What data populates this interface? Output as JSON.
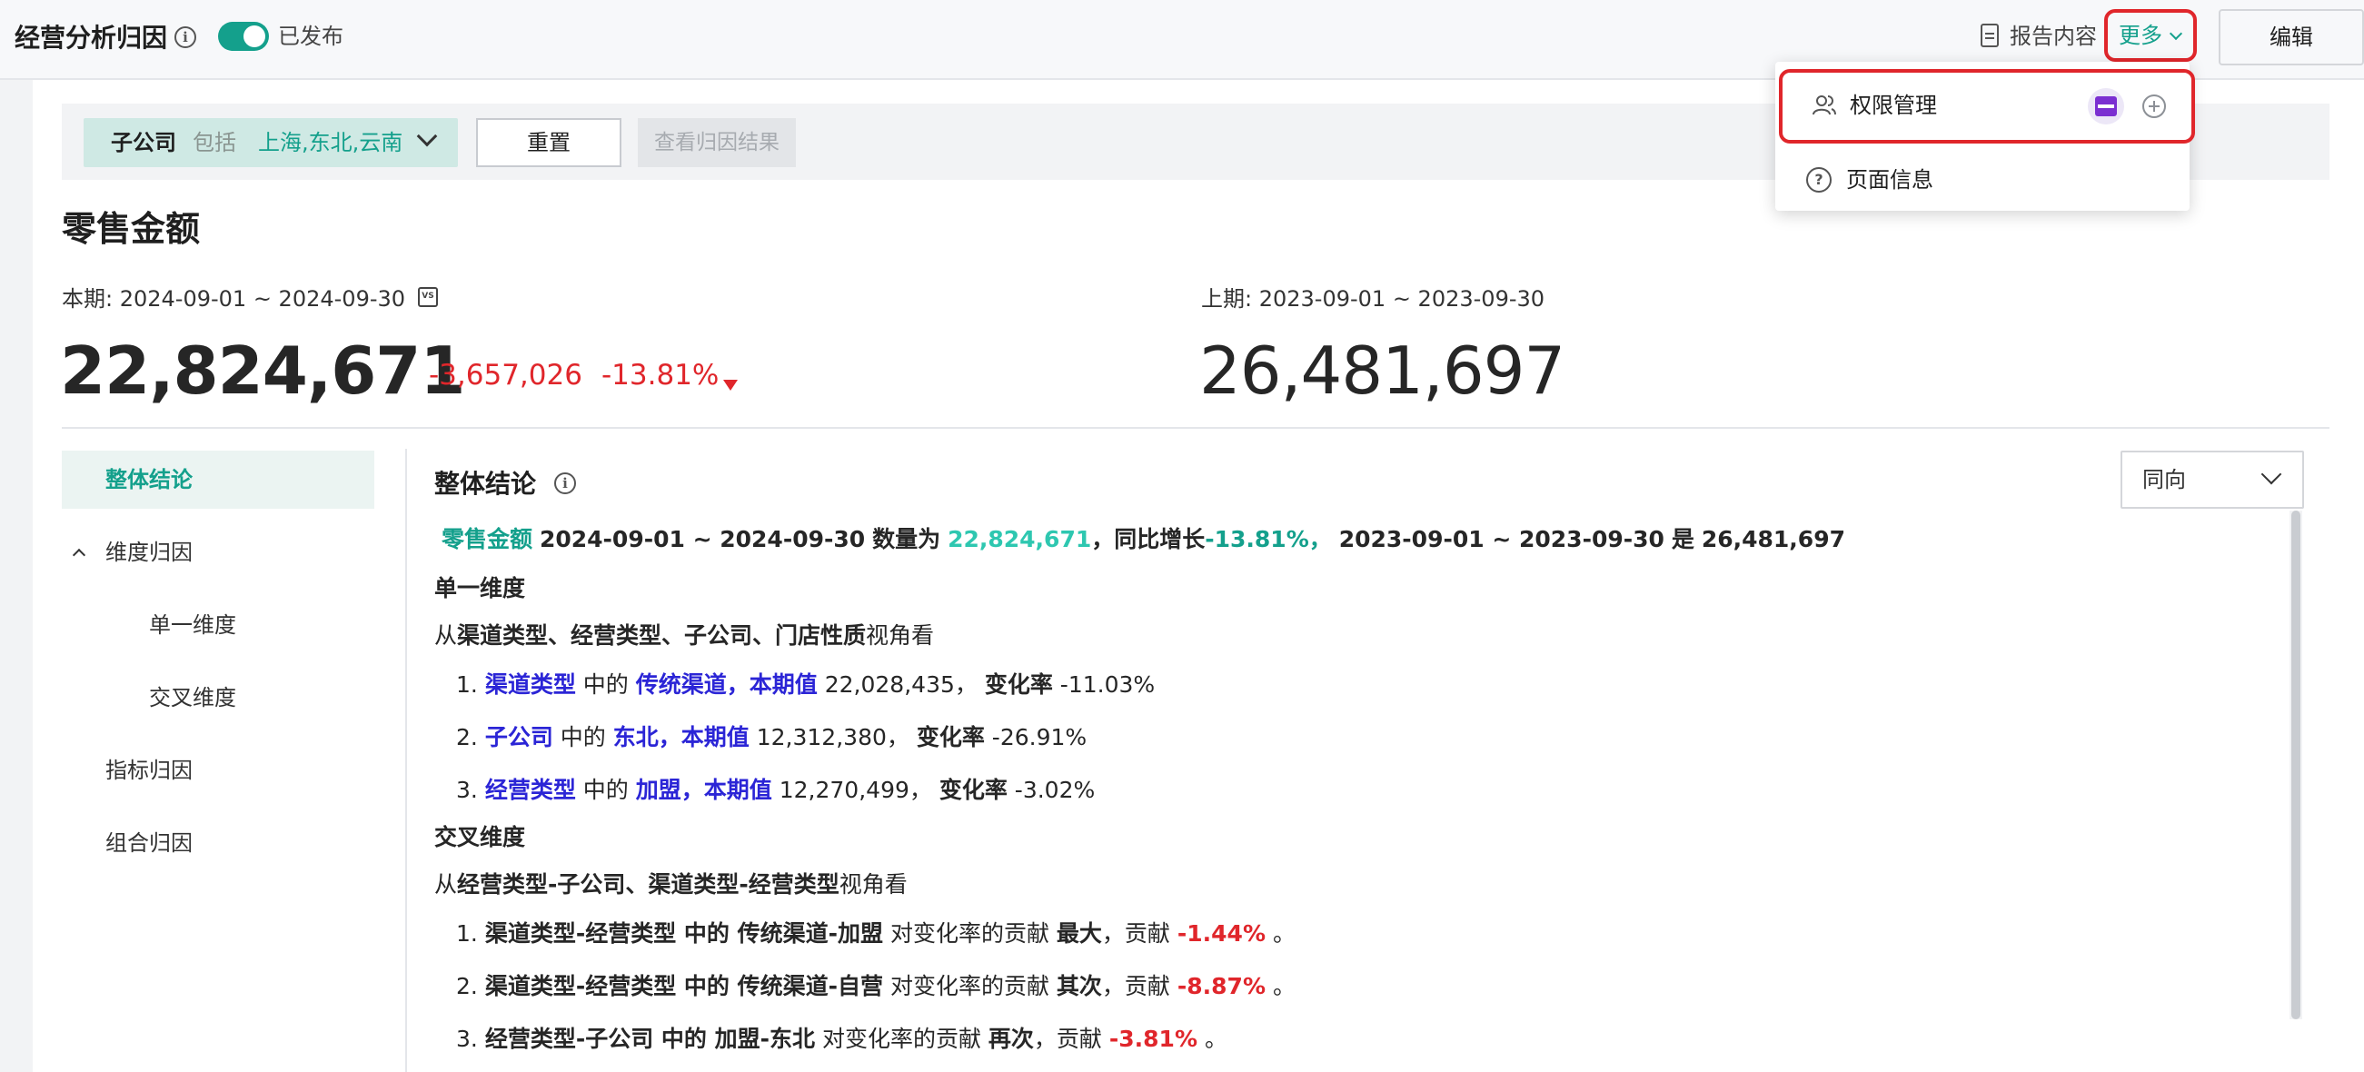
{
  "header": {
    "title": "经营分析归因",
    "publish_label": "已发布",
    "report_content": "报告内容",
    "more_label": "更多",
    "edit_label": "编辑"
  },
  "filter": {
    "key": "子公司",
    "op": "包括",
    "value": "上海,东北,云南",
    "reset_label": "重置",
    "view_label": "查看归因结果"
  },
  "metric": {
    "title": "零售金额",
    "current_period": "本期: 2024-09-01 ~ 2024-09-30",
    "vs_icon": "VS",
    "previous_period": "上期: 2023-09-01 ~ 2023-09-30",
    "current_value": "22,824,671",
    "change": "-3,657,026",
    "change_pct": "-13.81%",
    "previous_value": "26,481,697"
  },
  "side_nav": {
    "items": [
      "整体结论",
      "维度归因",
      "单一维度",
      "交叉维度",
      "指标归因",
      "组合归因"
    ]
  },
  "content": {
    "section_title": "整体结论",
    "direction_select": "同向",
    "summary": {
      "metric": "零售金额",
      "period": "2024-09-01 ~ 2024-09-30",
      "count_label": "数量为",
      "value": "22,824,671",
      "growth_label": "，同比增长",
      "growth_value": "-13.81%，",
      "prev_period": "2023-09-01 ~ 2023-09-30",
      "is_label": "是",
      "prev_value": "26,481,697"
    },
    "single": {
      "title": "单一维度",
      "intro_prefix": "从",
      "intro_dims": "渠道类型、经营类型、子公司、门店性质",
      "intro_suffix": "视角看",
      "items": [
        {
          "num": "1.",
          "dim": "渠道类型",
          "mid": "中的",
          "val": "传统渠道，",
          "label": "本期值",
          "cur": "22,028,435，",
          "rate_label": "变化率",
          "rate": "-11.03%"
        },
        {
          "num": "2.",
          "dim": "子公司",
          "mid": "中的",
          "val": "东北，",
          "label": "本期值",
          "cur": "12,312,380，",
          "rate_label": "变化率",
          "rate": "-26.91%"
        },
        {
          "num": "3.",
          "dim": "经营类型",
          "mid": "中的",
          "val": "加盟，",
          "label": "本期值",
          "cur": "12,270,499，",
          "rate_label": "变化率",
          "rate": "-3.02%"
        }
      ]
    },
    "cross": {
      "title": "交叉维度",
      "intro_prefix": "从",
      "intro_dims": "经营类型-子公司、渠道类型-经营类型",
      "intro_suffix": "视角看",
      "items": [
        {
          "num": "1.",
          "dims": "渠道类型-经营类型 中的 传统渠道-加盟",
          "mid": "对变化率的贡献",
          "rank": "最大",
          "contrib_label": "，贡献",
          "contrib": "-1.44%",
          "end": "。"
        },
        {
          "num": "2.",
          "dims": "渠道类型-经营类型 中的 传统渠道-自营",
          "mid": "对变化率的贡献",
          "rank": "其次",
          "contrib_label": "，贡献",
          "contrib": "-8.87%",
          "end": "。"
        },
        {
          "num": "3.",
          "dims": "经营类型-子公司 中的 加盟-东北",
          "mid": "对变化率的贡献",
          "rank": "再次",
          "contrib_label": "，贡献",
          "contrib": "-3.81%",
          "end": "。"
        }
      ]
    }
  },
  "dropdown": {
    "permission_label": "权限管理",
    "page_info_label": "页面信息"
  },
  "colors": {
    "accent": "#14a08c",
    "danger": "#e0262b",
    "link_blue": "#2b25d6"
  }
}
